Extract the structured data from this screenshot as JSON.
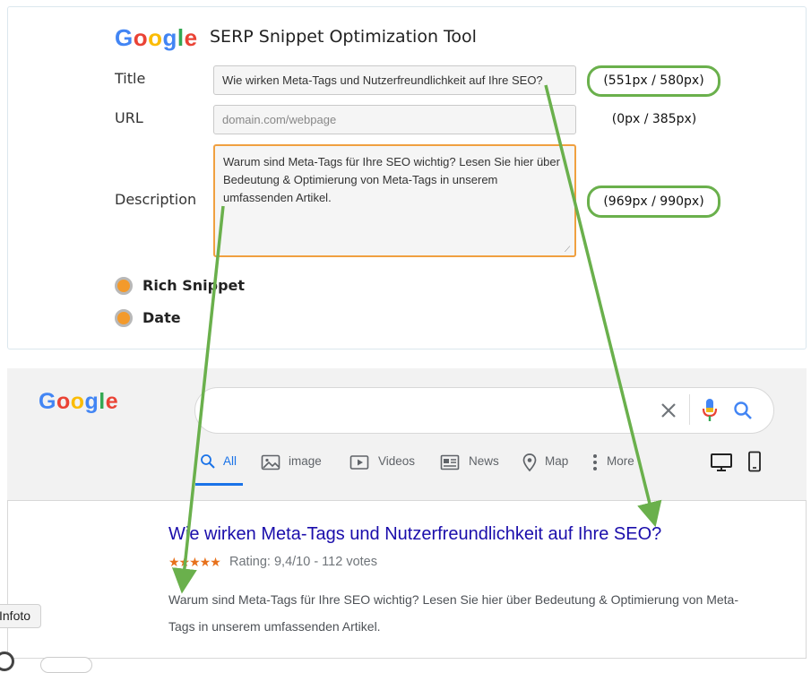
{
  "tool": {
    "logo": "Google",
    "heading": "SERP Snippet Optimization Tool",
    "title_label": "Title",
    "url_label": "URL",
    "description_label": "Description",
    "title_value": "Wie wirken Meta-Tags und Nutzerfreundlichkeit auf Ihre SEO?",
    "url_placeholder": "domain.com/webpage",
    "description_value": "Warum sind Meta-Tags für Ihre SEO wichtig? Lesen Sie hier über Bedeutung & Optimierung von Meta-Tags in unserem umfassenden Artikel.",
    "title_counter": "(551px / 580px)",
    "url_counter": "(0px / 385px)",
    "description_counter": "(969px / 990px)",
    "rich_snippet_label": "Rich Snippet",
    "date_label": "Date"
  },
  "preview": {
    "logo": "Google",
    "tabs": [
      {
        "label": "All",
        "icon": "search-icon",
        "active": true
      },
      {
        "label": "image",
        "icon": "image-icon"
      },
      {
        "label": "Videos",
        "icon": "video-icon"
      },
      {
        "label": "News",
        "icon": "news-icon"
      },
      {
        "label": "Map",
        "icon": "map-pin-icon"
      },
      {
        "label": "More",
        "icon": "more-vertical-icon"
      }
    ],
    "result": {
      "title": "Wie wirken Meta-Tags und Nutzerfreundlichkeit auf Ihre SEO?",
      "stars": "★★★★★",
      "rating": "Rating: 9,4/10 - 112 votes",
      "description": "Warum sind Meta-Tags für Ihre SEO wichtig? Lesen Sie hier über Bedeutung & Optimierung von Meta-Tags in unserem umfassenden Artikel."
    }
  },
  "tooltip": "Infoto",
  "colors": {
    "accent_green": "#6ab04c",
    "focus_orange": "#f0a040",
    "radio_orange": "#f39a2b",
    "link_blue": "#1a0dab",
    "tab_blue": "#1a73e8",
    "star_orange": "#e7711b"
  }
}
